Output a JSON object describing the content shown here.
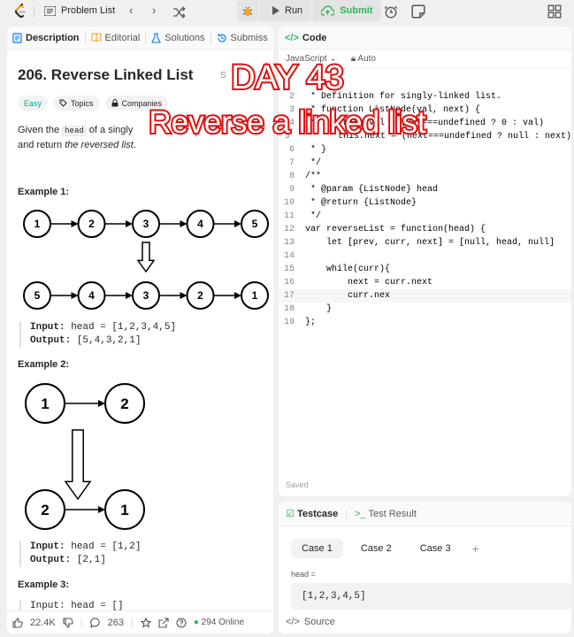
{
  "topbar": {
    "problem_list": "Problem List",
    "run": "Run",
    "submit": "Submit"
  },
  "left": {
    "tabs": [
      {
        "label": "Description"
      },
      {
        "label": "Editorial"
      },
      {
        "label": "Solutions"
      },
      {
        "label": "Submiss"
      }
    ],
    "title": "206. Reverse Linked List",
    "solved_label": "S",
    "badges": {
      "difficulty": "Easy",
      "topics": "Topics",
      "companies": "Companies"
    },
    "desc": {
      "p1": "Given the ",
      "code": "head",
      "p2": " of a singly",
      "p3": "and return ",
      "italic": "the reversed list",
      "p4": "."
    },
    "example1": {
      "heading": "Example 1:",
      "input_label": "Input:",
      "input_value": " head = [1,2,3,4,5]",
      "output_label": "Output:",
      "output_value": " [5,4,3,2,1]",
      "top_row": [
        "1",
        "2",
        "3",
        "4",
        "5"
      ],
      "bottom_row": [
        "5",
        "4",
        "3",
        "2",
        "1"
      ]
    },
    "example2": {
      "heading": "Example 2:",
      "input_label": "Input:",
      "input_value": " head = [1,2]",
      "output_label": "Output:",
      "output_value": " [2,1]",
      "top_row": [
        "1",
        "2"
      ],
      "bottom_row": [
        "2",
        "1"
      ]
    },
    "example3": {
      "heading": "Example 3:",
      "input_partial": "Input: head = []"
    },
    "footer": {
      "likes": "22.4K",
      "comments": "263",
      "online": "294 Online"
    }
  },
  "code": {
    "header": "Code",
    "language": "JavaScript",
    "auto": "Auto",
    "saved": "Saved",
    "lines": [
      {
        "n": "2",
        "t": " * Definition for singly-linked list.",
        "c": "com"
      },
      {
        "n": "3",
        "t": " * function ListNode(val, next) {",
        "c": "com"
      },
      {
        "n": "4",
        "t": " *     this.val = (val===undefined ? 0 : val)",
        "c": "com"
      },
      {
        "n": "5",
        "t": " *     this.next = (next===undefined ? null : next)",
        "c": "com"
      },
      {
        "n": "6",
        "t": " * }",
        "c": "com"
      },
      {
        "n": "7",
        "t": " */",
        "c": "com"
      },
      {
        "n": "8",
        "t": "/**",
        "c": "com"
      },
      {
        "n": "9",
        "t": " * @param {ListNode} head",
        "c": "com"
      },
      {
        "n": "10",
        "t": " * @return {ListNode}",
        "c": "com"
      },
      {
        "n": "11",
        "t": " */",
        "c": "com"
      },
      {
        "n": "12",
        "t": "var reverseList = function(head) {",
        "c": "code"
      },
      {
        "n": "13",
        "t": "    let [prev, curr, next] = [null, head, null]",
        "c": "code"
      },
      {
        "n": "14",
        "t": "",
        "c": "code"
      },
      {
        "n": "15",
        "t": "    while(curr){",
        "c": "code"
      },
      {
        "n": "16",
        "t": "        next = curr.next",
        "c": "code"
      },
      {
        "n": "17",
        "t": "        curr.nex",
        "c": "code"
      },
      {
        "n": "18",
        "t": "    }",
        "c": "code"
      },
      {
        "n": "19",
        "t": "};",
        "c": "code"
      }
    ]
  },
  "test": {
    "testcase_tab": "Testcase",
    "result_tab": "Test Result",
    "cases": [
      "Case 1",
      "Case 2",
      "Case 3"
    ],
    "param_label": "head =",
    "param_value": "[1,2,3,4,5]",
    "source": "Source"
  },
  "overlay": {
    "line1": "DAY 43",
    "line2": "Reverse a linked list"
  },
  "colors": {
    "accent_green": "#2cb55d",
    "overlay_red": "#e10e0e",
    "easy": "#00a88e"
  }
}
